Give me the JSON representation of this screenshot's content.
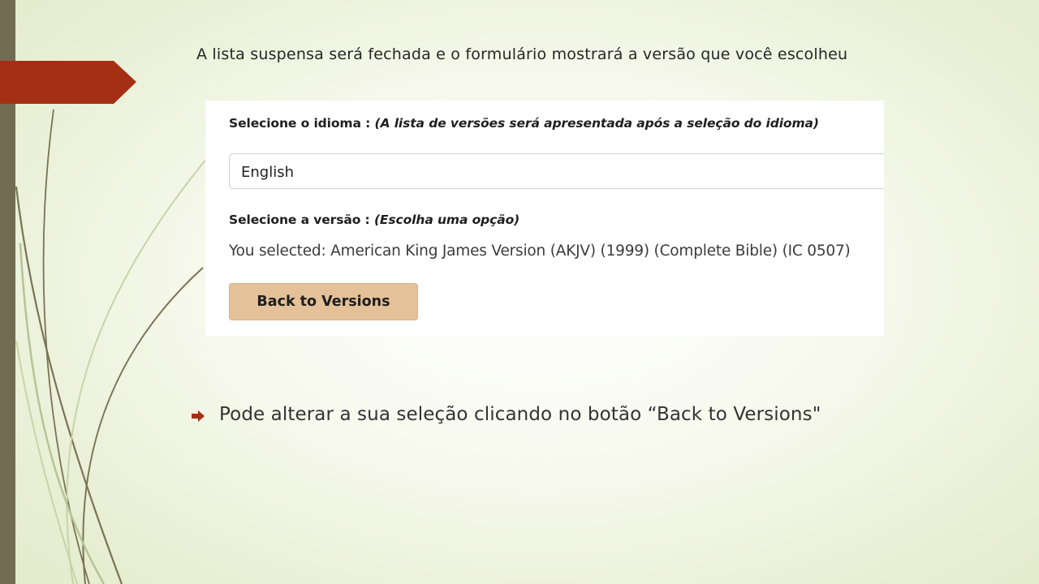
{
  "slide": {
    "title": "A lista suspensa será fechada e o formulário mostrará a versão que você escolheu",
    "bullet_text": "Pode alterar a sua seleção clicando no botão “Back to Versions\"",
    "colors": {
      "accent": "#a52f12",
      "left_bar": "#736b52",
      "deco_line": "#7a7355",
      "deco_line_light": "#c9d3a8"
    },
    "icons": {
      "bullet": "right-arrow-bullet-icon",
      "banner": "arrow-banner"
    }
  },
  "form": {
    "language_label": "Selecione o idioma : ",
    "language_hint": "(A lista de versões será apresentada após a seleção do idioma)",
    "language_value": "English",
    "version_label": "Selecione a versão : ",
    "version_hint": "(Escolha uma opção)",
    "selected_text": "You selected: American King James Version (AKJV) (1999) (Complete Bible) (IC 0507)",
    "back_button": "Back to Versions",
    "colors": {
      "button_bg": "#e4c198"
    }
  }
}
